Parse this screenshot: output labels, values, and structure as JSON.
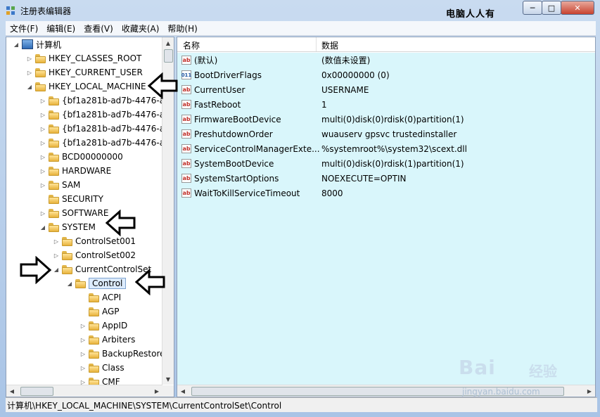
{
  "window": {
    "title": "注册表编辑器",
    "watermark_text": "电脑人人有",
    "controls": {
      "minimize": "─",
      "maximize": "□",
      "close": "✕"
    }
  },
  "menu": [
    "文件(F)",
    "编辑(E)",
    "查看(V)",
    "收藏夹(A)",
    "帮助(H)"
  ],
  "tree": {
    "root": "计算机",
    "items": [
      {
        "label": "HKEY_CLASSES_ROOT",
        "depth": 1,
        "state": "collapsed"
      },
      {
        "label": "HKEY_CURRENT_USER",
        "depth": 1,
        "state": "collapsed"
      },
      {
        "label": "HKEY_LOCAL_MACHINE",
        "depth": 1,
        "state": "expanded"
      },
      {
        "label": "{bf1a281b-ad7b-4476-a",
        "depth": 2,
        "state": "collapsed"
      },
      {
        "label": "{bf1a281b-ad7b-4476-a",
        "depth": 2,
        "state": "collapsed"
      },
      {
        "label": "{bf1a281b-ad7b-4476-a",
        "depth": 2,
        "state": "collapsed"
      },
      {
        "label": "{bf1a281b-ad7b-4476-a",
        "depth": 2,
        "state": "collapsed"
      },
      {
        "label": "BCD00000000",
        "depth": 2,
        "state": "collapsed"
      },
      {
        "label": "HARDWARE",
        "depth": 2,
        "state": "collapsed"
      },
      {
        "label": "SAM",
        "depth": 2,
        "state": "collapsed"
      },
      {
        "label": "SECURITY",
        "depth": 2,
        "state": "none"
      },
      {
        "label": "SOFTWARE",
        "depth": 2,
        "state": "collapsed"
      },
      {
        "label": "SYSTEM",
        "depth": 2,
        "state": "expanded"
      },
      {
        "label": "ControlSet001",
        "depth": 3,
        "state": "collapsed"
      },
      {
        "label": "ControlSet002",
        "depth": 3,
        "state": "collapsed"
      },
      {
        "label": "CurrentControlSet",
        "depth": 3,
        "state": "expanded"
      },
      {
        "label": "Control",
        "depth": 4,
        "state": "expanded",
        "selected": true
      },
      {
        "label": "ACPI",
        "depth": 5,
        "state": "none"
      },
      {
        "label": "AGP",
        "depth": 5,
        "state": "none"
      },
      {
        "label": "AppID",
        "depth": 5,
        "state": "collapsed"
      },
      {
        "label": "Arbiters",
        "depth": 5,
        "state": "collapsed"
      },
      {
        "label": "BackupRestore",
        "depth": 5,
        "state": "collapsed"
      },
      {
        "label": "Class",
        "depth": 5,
        "state": "collapsed"
      },
      {
        "label": "CMF",
        "depth": 5,
        "state": "collapsed"
      }
    ]
  },
  "list": {
    "headers": {
      "name": "名称",
      "data": "数据"
    },
    "rows": [
      {
        "name": "(默认)",
        "data": "(数值未设置)",
        "type": "string"
      },
      {
        "name": "BootDriverFlags",
        "data": "0x00000000 (0)",
        "type": "binary"
      },
      {
        "name": "CurrentUser",
        "data": "USERNAME",
        "type": "string"
      },
      {
        "name": "FastReboot",
        "data": "1",
        "type": "string"
      },
      {
        "name": "FirmwareBootDevice",
        "data": "multi(0)disk(0)rdisk(0)partition(1)",
        "type": "string"
      },
      {
        "name": "PreshutdownOrder",
        "data": "wuauserv gpsvc trustedinstaller",
        "type": "string"
      },
      {
        "name": "ServiceControlManagerExte...",
        "data": "%systemroot%\\system32\\scext.dll",
        "type": "string"
      },
      {
        "name": "SystemBootDevice",
        "data": "multi(0)disk(0)rdisk(1)partition(1)",
        "type": "string"
      },
      {
        "name": "SystemStartOptions",
        "data": " NOEXECUTE=OPTIN",
        "type": "string"
      },
      {
        "name": "WaitToKillServiceTimeout",
        "data": "8000",
        "type": "string"
      }
    ]
  },
  "status": {
    "path": "计算机\\HKEY_LOCAL_MACHINE\\SYSTEM\\CurrentControlSet\\Control"
  },
  "icons": {
    "string": "ab",
    "binary": "011"
  },
  "watermark": {
    "brand": "Bai",
    "cn": "经验",
    "url": "jingyan.baidu.com"
  }
}
